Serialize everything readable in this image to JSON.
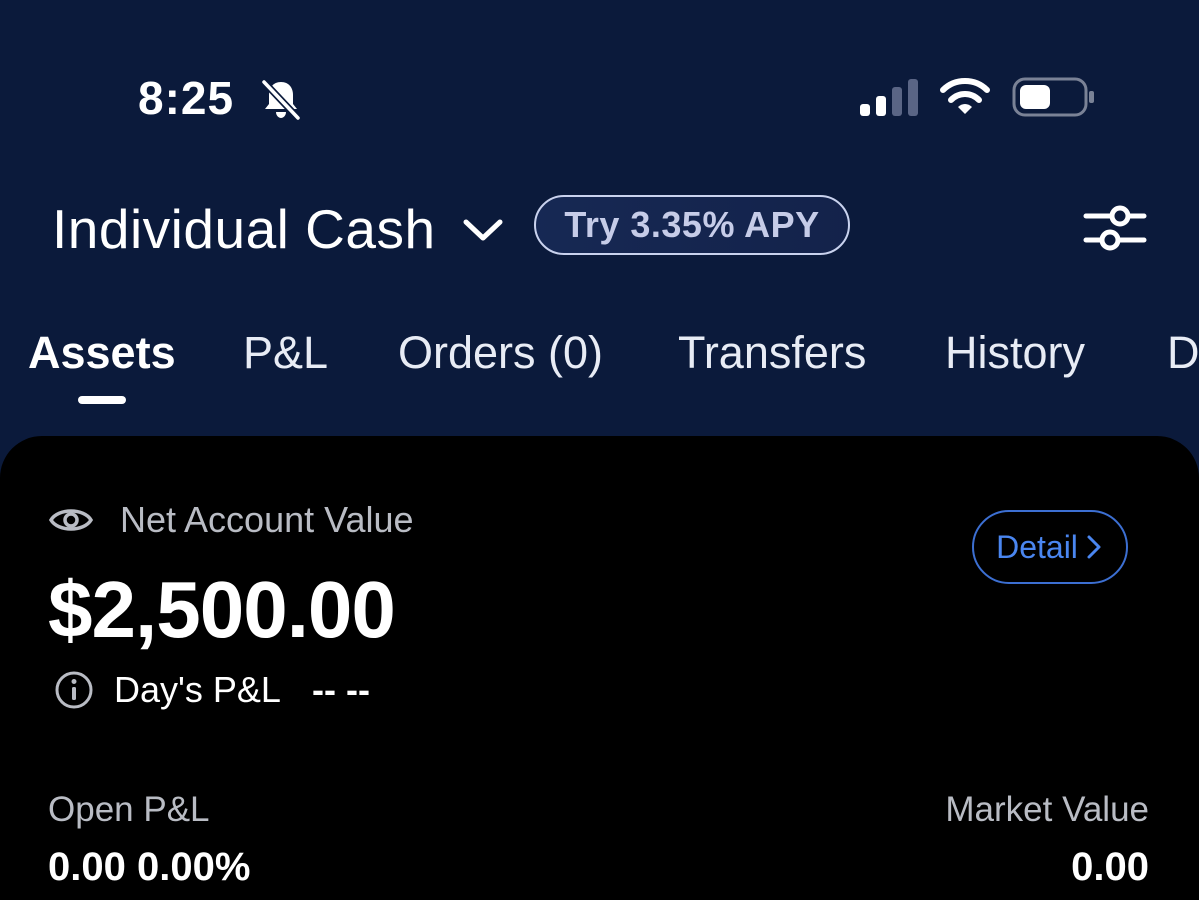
{
  "status_bar": {
    "time": "8:25",
    "icons": [
      "bell-slash-icon",
      "signal-icon",
      "wifi-icon",
      "battery-icon"
    ]
  },
  "header": {
    "account_name": "Individual Cash",
    "apy_label": "Try 3.35% APY",
    "icons": [
      "chevron-down-icon",
      "filter-sliders-icon"
    ]
  },
  "tabs": [
    {
      "label": "Assets",
      "active": true
    },
    {
      "label": "P&L",
      "active": false
    },
    {
      "label": "Orders (0)",
      "active": false
    },
    {
      "label": "Transfers",
      "active": false
    },
    {
      "label": "History",
      "active": false
    },
    {
      "label": "D",
      "active": false
    }
  ],
  "summary": {
    "net_account_value_label": "Net Account Value",
    "net_account_value": "$2,500.00",
    "detail_label": "Detail",
    "days_pl_label": "Day's P&L",
    "days_pl_value": "-- --",
    "open_pl_label": "Open P&L",
    "open_pl_value": "0.00 0.00%",
    "market_value_label": "Market Value",
    "market_value": "0.00"
  },
  "colors": {
    "background": "#0b1a3b",
    "card": "#000000",
    "accent": "#4a86f0",
    "muted_text": "#b9bcc4"
  }
}
